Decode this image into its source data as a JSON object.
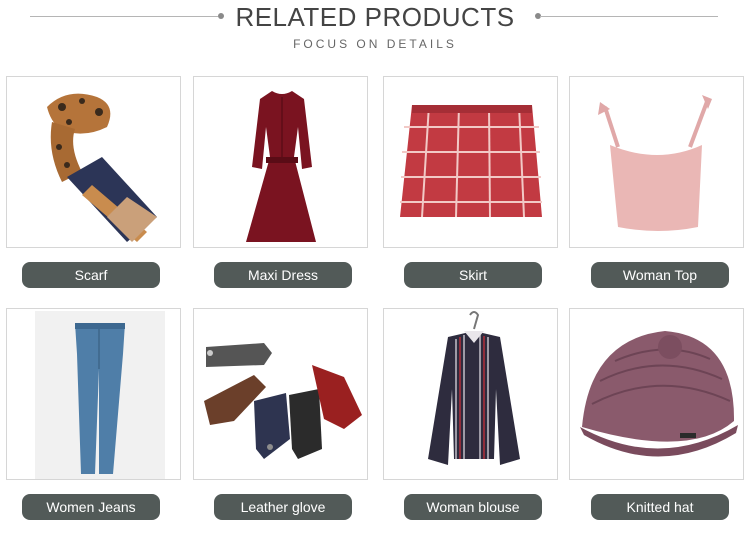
{
  "header": {
    "title": "RELATED PRODUCTS",
    "subtitle": "FOCUS ON DETAILS"
  },
  "products": [
    {
      "name": "Scarf",
      "icon": "scarf-image"
    },
    {
      "name": "Maxi Dress",
      "icon": "maxi-dress-image"
    },
    {
      "name": "Skirt",
      "icon": "skirt-image"
    },
    {
      "name": "Woman Top",
      "icon": "woman-top-image"
    },
    {
      "name": "Women Jeans",
      "icon": "women-jeans-image"
    },
    {
      "name": "Leather glove",
      "icon": "leather-glove-image"
    },
    {
      "name": "Woman blouse",
      "icon": "woman-blouse-image"
    },
    {
      "name": "Knitted hat",
      "icon": "knitted-hat-image"
    }
  ],
  "colors": {
    "label_bg": "#525a58",
    "label_text": "#ffffff",
    "title_text": "#444444",
    "card_border": "#d6d6d6"
  }
}
